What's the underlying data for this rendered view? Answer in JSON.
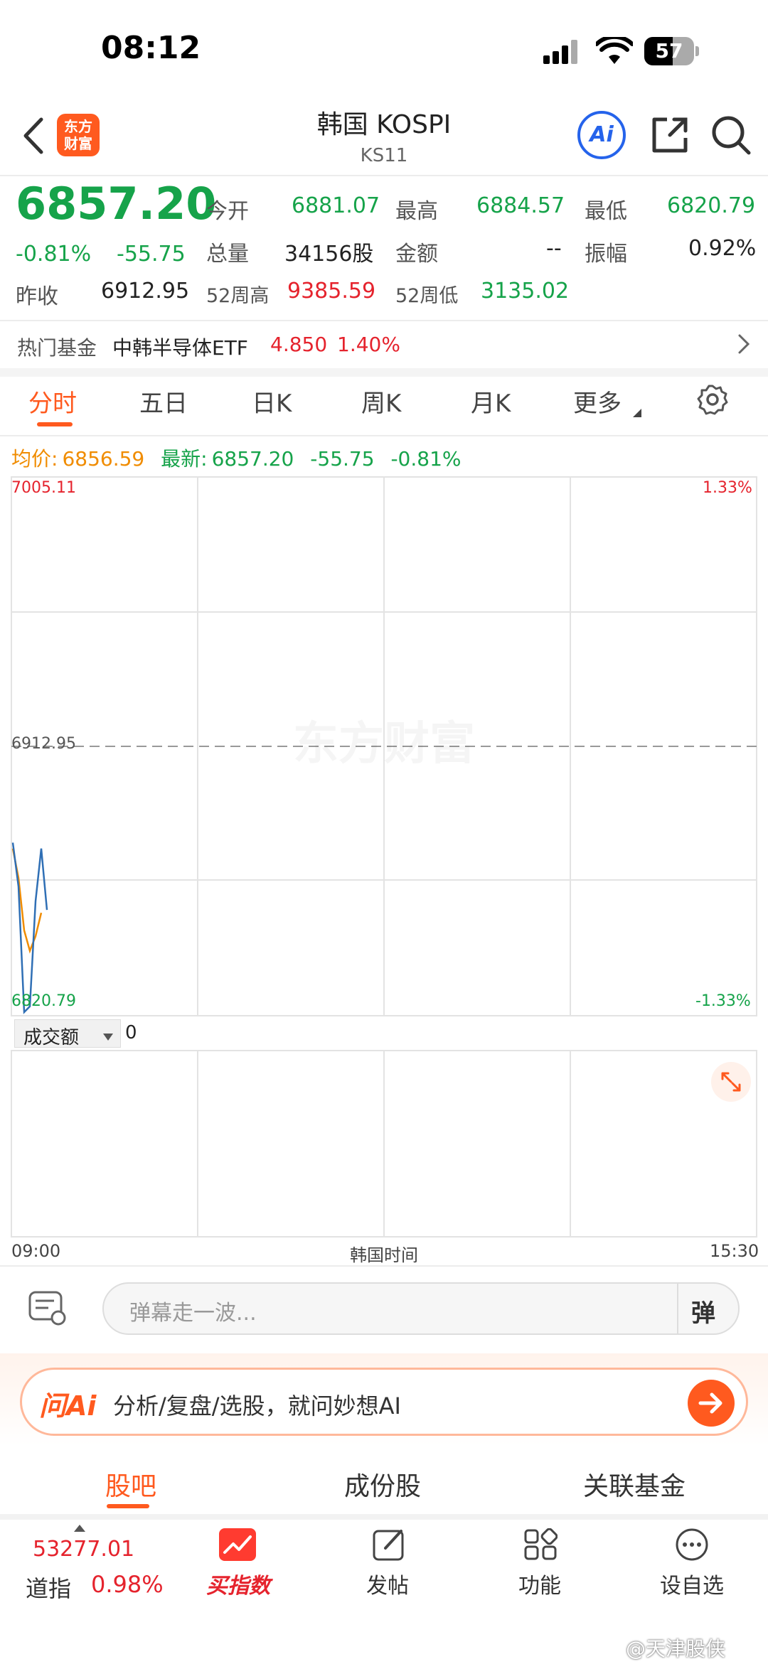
{
  "status": {
    "time": "08:12",
    "battery": "57"
  },
  "header": {
    "logo_line1": "东方",
    "logo_line2": "财富",
    "title": "韩国 KOSPI",
    "code": "KS11",
    "ai_label": "Ai"
  },
  "quote": {
    "price": "6857.20",
    "change_pct": "-0.81%",
    "change": "-55.75",
    "open_label": "今开",
    "open": "6881.07",
    "high_label": "最高",
    "high": "6884.57",
    "low_label": "最低",
    "low": "6820.79",
    "volume_label": "总量",
    "volume": "34156股",
    "amount_label": "金额",
    "amount": "--",
    "amplitude_label": "振幅",
    "amplitude": "0.92%",
    "prev_close_label": "昨收",
    "prev_close": "6912.95",
    "w52_high_label": "52周高",
    "w52_high": "9385.59",
    "w52_low_label": "52周低",
    "w52_low": "3135.02"
  },
  "hot_fund": {
    "label": "热门基金",
    "name": "中韩半导体ETF",
    "price": "4.850",
    "pct": "1.40%"
  },
  "tabs": [
    "分时",
    "五日",
    "日K",
    "周K",
    "月K",
    "更多"
  ],
  "chart_info": {
    "avg_label": "均价:",
    "avg": "6856.59",
    "latest_label": "最新:",
    "latest": "6857.20",
    "latest_change": "-55.75",
    "latest_pct": "-0.81%"
  },
  "chart_data": {
    "type": "line",
    "y_top": "7005.11",
    "y_mid": "6912.95",
    "y_bottom": "6820.79",
    "pct_top": "1.33%",
    "pct_bottom": "-1.33%",
    "ylim": [
      6820.79,
      7005.11
    ],
    "x_start": "09:00",
    "x_end": "15:30",
    "x_label": "韩国时间",
    "series": [
      {
        "values": [
          6880,
          6865,
          6822,
          6824,
          6860,
          6878,
          6857
        ],
        "color": "#2f6fb5"
      },
      {
        "values": [
          6878,
          6868,
          6850,
          6843,
          6848,
          6856
        ],
        "color": "#f08c00"
      }
    ],
    "colors": {
      "price_line": "#2f6fb5",
      "avg_line": "#f08c00"
    }
  },
  "volume_panel": {
    "selector": "成交额",
    "value": "0"
  },
  "danmaku": {
    "placeholder": "弹幕走一波...",
    "button": "弹"
  },
  "ask_ai": {
    "logo": "问Ai",
    "prompt": "分析/复盘/选股，就问妙想AI"
  },
  "section_tabs": [
    "股吧",
    "成份股",
    "关联基金"
  ],
  "bottom_nav": {
    "ticker_price": "53277.01",
    "ticker_name": "道指",
    "ticker_pct": "0.98%",
    "items": [
      "买指数",
      "发帖",
      "功能",
      "设自选"
    ]
  },
  "watermark": "@天津股侠",
  "accent": "#ff5a1f"
}
